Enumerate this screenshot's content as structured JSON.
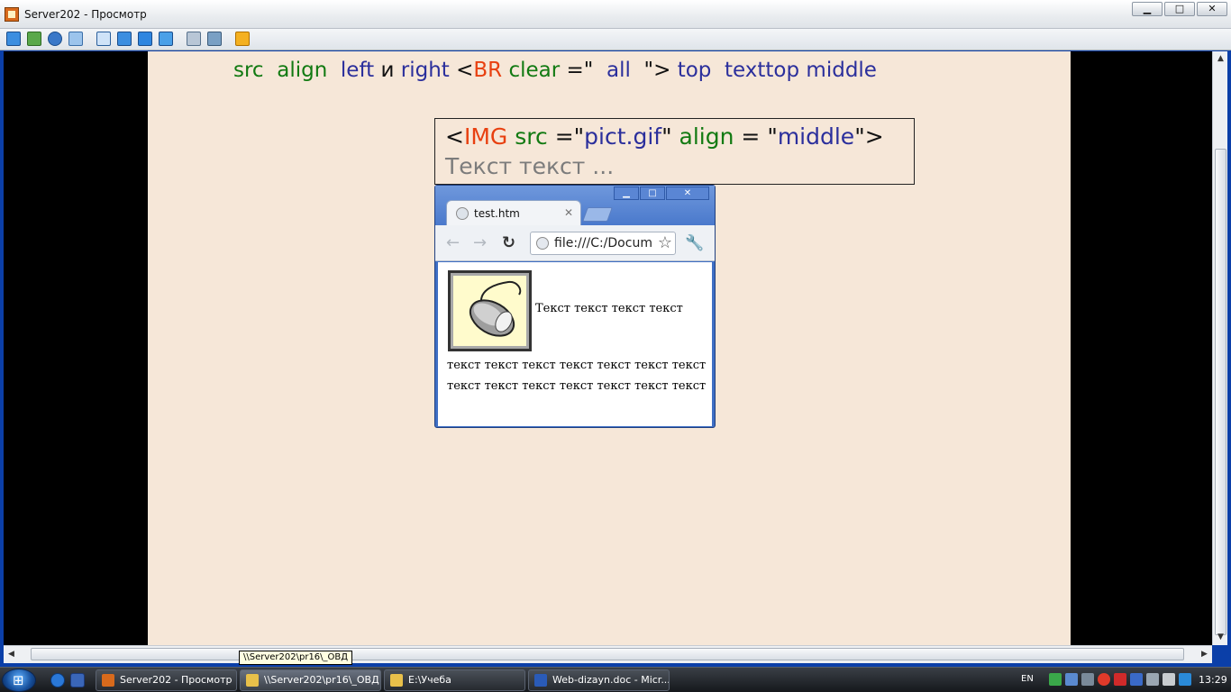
{
  "window": {
    "title": "Server202 - Просмотр",
    "caption_buttons": {
      "minimize": "▁",
      "maximize": "□",
      "close": "✕"
    }
  },
  "toolbar": {
    "icons": [
      "monitor-icon",
      "chat-icon",
      "phone-icon",
      "message-icon",
      "window-icon",
      "fullscreen-icon",
      "screen-icon",
      "zoom-icon",
      "capture-icon",
      "tools-icon",
      "close-icon"
    ]
  },
  "slide": {
    "code_line": {
      "src": "src",
      "align": "align",
      "left": "left",
      "and": "и",
      "right": "right",
      "lt": "<",
      "br": "BR",
      "clear": "clear",
      "eq": "=\"",
      "all": "all",
      "close": "\">",
      "top": "top",
      "texttop": "texttop",
      "middle": "middle"
    },
    "codebox": {
      "lt": "<",
      "img": "IMG",
      "src": "src",
      "eq1": "=\"",
      "pict": "pict.gif",
      "q1": "\"",
      "align": "align",
      "eq2": "= \"",
      "middle": "middle",
      "end": "\">",
      "text": "Текст текст ..."
    },
    "browser": {
      "tab_title": "test.htm",
      "tab_close": "✕",
      "url": "file:///C:/Documents",
      "text_line1": "Текст текст текст текст",
      "text_rest": "текст текст текст текст текст текст текст текст текст текст текст текст текст текст"
    }
  },
  "tooltip": "\\\\Server202\\pr16\\_ОВД",
  "taskbar": {
    "tasks": [
      {
        "label": "Server202 - Просмотр",
        "active": false
      },
      {
        "label": "\\\\Server202\\pr16\\_ОВД",
        "active": true
      },
      {
        "label": "E:\\Учеба",
        "active": false
      },
      {
        "label": "Web-dizayn.doc - Micr...",
        "active": false
      }
    ],
    "language": "EN",
    "clock": "13:29"
  },
  "colors": {
    "slide_background": "#f6e7d8",
    "code_green": "#127a12",
    "code_blue": "#2b2f9c",
    "code_red": "#e84010",
    "gray_text": "#7c7c7c"
  }
}
